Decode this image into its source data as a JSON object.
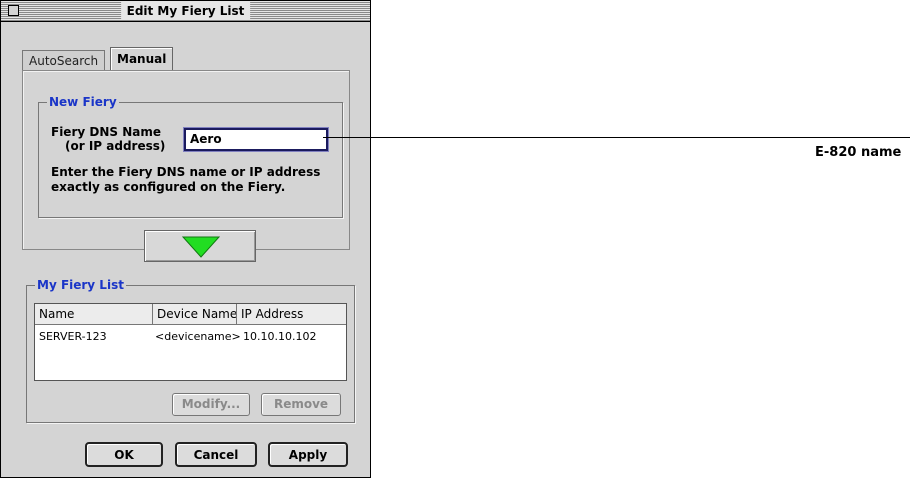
{
  "window": {
    "title": "Edit My Fiery List"
  },
  "tabs": [
    {
      "label": "AutoSearch",
      "selected": false
    },
    {
      "label": "Manual",
      "selected": true
    }
  ],
  "new_fiery": {
    "legend": "New Fiery",
    "field_label_line1": "Fiery DNS Name",
    "field_label_line2": "(or IP address)",
    "field_value": "Aero",
    "help_line1": "Enter the Fiery DNS name or IP address",
    "help_line2": "exactly as configured on the Fiery."
  },
  "add_button": {
    "icon": "green-down-arrow-icon",
    "color": "#22dd22"
  },
  "my_fiery_list": {
    "legend": "My Fiery List",
    "columns": [
      "Name",
      "Device Name",
      "IP Address"
    ],
    "rows": [
      [
        "SERVER-123",
        "<devicename>",
        "10.10.10.102"
      ]
    ],
    "modify_label": "Modify...",
    "remove_label": "Remove"
  },
  "dialog_buttons": {
    "ok": "OK",
    "cancel": "Cancel",
    "apply": "Apply"
  },
  "callout": {
    "label": "E-820 name"
  },
  "colors": {
    "legend": "#1a35c8",
    "window_bg": "#d4d4d4"
  }
}
